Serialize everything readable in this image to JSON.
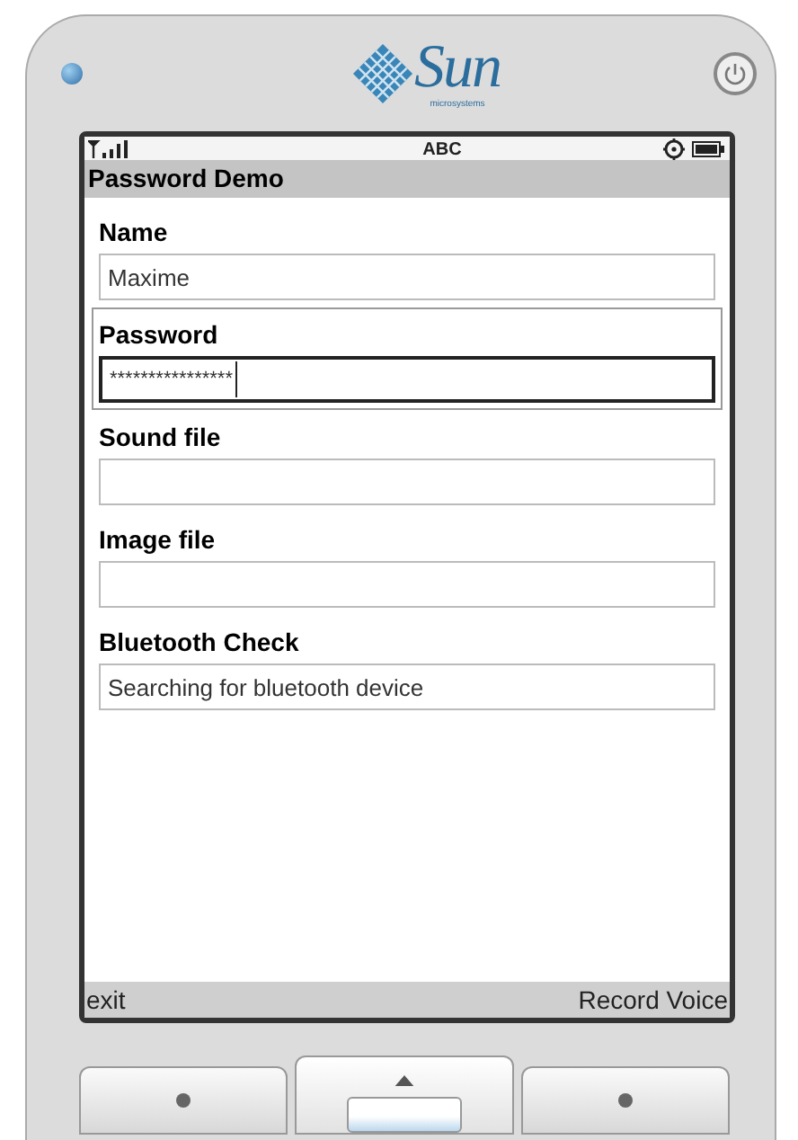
{
  "logo": {
    "wordmark": "Sun",
    "tagline": "microsystems"
  },
  "status_bar": {
    "input_mode": "ABC"
  },
  "title": "Password Demo",
  "form": [
    {
      "label": "Name",
      "value": "Maxime",
      "focused": false
    },
    {
      "label": "Password",
      "value": "****************",
      "focused": true
    },
    {
      "label": "Sound file",
      "focused": false
    },
    {
      "label": "Image file",
      "focused": false
    },
    {
      "label": "Bluetooth Check",
      "value": "Searching for bluetooth device",
      "focused": false
    }
  ],
  "soft_keys": [
    "exit",
    "Record Voice"
  ]
}
